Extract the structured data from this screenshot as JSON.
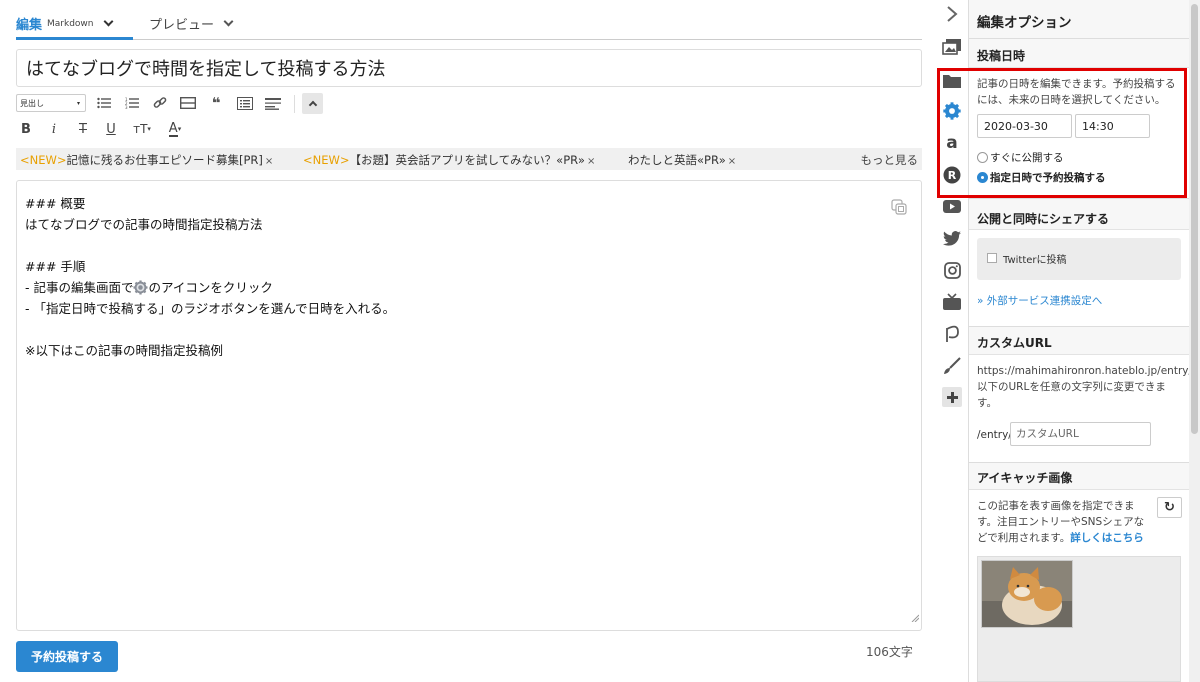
{
  "tabs": {
    "edit_label": "編集",
    "edit_mode": "Markdown",
    "preview_label": "プレビュー"
  },
  "title_value": "はてなブログで時間を指定して投稿する方法",
  "toolbar": {
    "heading_select": "見出し"
  },
  "topics": [
    {
      "new": "<NEW>",
      "text": "記憶に残るお仕事エピソード募集[PR]"
    },
    {
      "new": "<NEW>",
      "text": "【お題】英会話アプリを試してみない？«PR»"
    },
    {
      "new": "",
      "text": "わたしと英語«PR»"
    }
  ],
  "topics_more": "もっと見る",
  "topic_close": "×",
  "body_lines": {
    "l1": "### 概要",
    "l2": "はてなブログでの記事の時間指定投稿方法",
    "l3": "### 手順",
    "l4a": "- 記事の編集画面で",
    "l4b": "のアイコンをクリック",
    "l5": "- 「指定日時で投稿する」のラジオボタンを選んで日時を入れる。",
    "l6": "※以下はこの記事の時間指定投稿例"
  },
  "submit_label": "予約投稿する",
  "char_count": "106文字",
  "rail_icons": [
    "chevron-right-icon",
    "photo-icon",
    "folder-icon",
    "gear-icon",
    "amazon-icon",
    "rakuten-icon",
    "youtube-icon",
    "twitter-icon",
    "instagram-icon",
    "tv-icon",
    "pixiv-icon",
    "brush-icon",
    "plus-icon"
  ],
  "colors": {
    "accent": "#2b87d1",
    "highlight": "#e00000",
    "new": "#e8a000"
  },
  "sidebar": {
    "title": "編集オプション",
    "schedule": {
      "title": "投稿日時",
      "desc1": "記事の日時を編集できます。予約投稿する",
      "desc2": "には、未来の日時を選択してください。",
      "date": "2020-03-30",
      "time": "14:30",
      "option_now": "すぐに公開する",
      "option_scheduled": "指定日時で予約投稿する"
    },
    "share": {
      "title": "公開と同時にシェアする",
      "twitter_label": "Twitterに投稿",
      "external_link": "» 外部サービス連携設定へ"
    },
    "custom_url": {
      "title": "カスタムURL",
      "desc1": "https://mahimahironron.hateblo.jp/entry/",
      "desc2": "以下のURLを任意の文字列に変更できま",
      "desc3": "す。",
      "prefix": "/entry/",
      "placeholder": "カスタムURL"
    },
    "eyecatch": {
      "title": "アイキャッチ画像",
      "desc1": "この記事を表す画像を指定できま",
      "desc2": "す。注目エントリーやSNSシェアな",
      "desc3": "どで利用されます。",
      "detail_link": "詳しくはこちら"
    }
  }
}
